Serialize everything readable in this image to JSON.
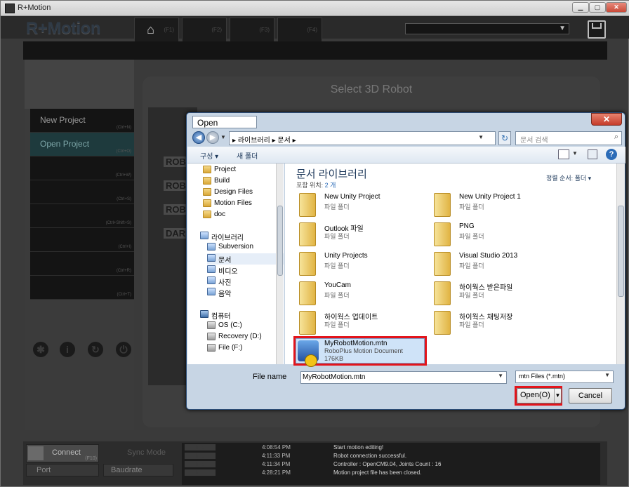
{
  "window": {
    "title": "R+Motion"
  },
  "header": {
    "logo": "R+Motion",
    "tabs": [
      {
        "label": "(F1)"
      },
      {
        "label": "(F2)"
      },
      {
        "label": "(F3)"
      },
      {
        "label": "(F4)"
      }
    ]
  },
  "main": {
    "select_title": "Select 3D Robot",
    "robots": [
      "ROB",
      "ROB",
      "ROB",
      "DAR"
    ]
  },
  "left_menu": {
    "items": [
      {
        "label": "New Project",
        "shortcut": "(Ctrl+N)"
      },
      {
        "label": "Open Project",
        "shortcut": "(Ctrl+O)"
      },
      {
        "label": "",
        "shortcut": "(Ctrl+W)"
      },
      {
        "label": "",
        "shortcut": "(Ctrl+S)"
      },
      {
        "label": "",
        "shortcut": "(Ctrl+Shift+S)"
      },
      {
        "label": "",
        "shortcut": "(Ctrl+I)"
      },
      {
        "label": "",
        "shortcut": "(Ctrl+R)"
      },
      {
        "label": "",
        "shortcut": "(Ctrl+T)"
      }
    ]
  },
  "status": {
    "connect": "Connect",
    "connect_shortcut": "(F10)",
    "sync_mode": "Sync Mode",
    "port": "Port",
    "baudrate": "Baudrate",
    "log": [
      {
        "level": "Info",
        "time": "4:08:54 PM",
        "msg": "Start motion editing!"
      },
      {
        "level": "Info",
        "time": "4:11:33 PM",
        "msg": "Robot connection successful."
      },
      {
        "level": "Info",
        "time": "4:11:34 PM",
        "msg": "Controller : OpenCM9.04, Joints Count : 16"
      },
      {
        "level": "Info",
        "time": "4:28:21 PM",
        "msg": "Motion project file has been closed."
      }
    ]
  },
  "dialog": {
    "title": "Open",
    "address": [
      "라이브러리",
      "문서"
    ],
    "search_placeholder": "문서 검색",
    "organize": "구성 ▾",
    "new_folder": "새 폴더",
    "nav": [
      {
        "label": "Project",
        "icon": "folder-icon"
      },
      {
        "label": "Build",
        "icon": "folder-icon"
      },
      {
        "label": "Design Files",
        "icon": "folder-icon"
      },
      {
        "label": "Motion Files",
        "icon": "folder-icon"
      },
      {
        "label": "doc",
        "icon": "folder-icon"
      },
      {
        "label": "라이브러리",
        "icon": "library-icon"
      },
      {
        "label": "Subversion",
        "icon": "library-icon"
      },
      {
        "label": "문서",
        "icon": "documents-icon"
      },
      {
        "label": "비디오",
        "icon": "video-icon"
      },
      {
        "label": "사진",
        "icon": "pictures-icon"
      },
      {
        "label": "음악",
        "icon": "music-icon"
      },
      {
        "label": "컴퓨터",
        "icon": "computer-icon"
      },
      {
        "label": "OS (C:)",
        "icon": "drive-icon"
      },
      {
        "label": "Recovery (D:)",
        "icon": "drive-icon"
      },
      {
        "label": "File (F:)",
        "icon": "drive-icon"
      }
    ],
    "library_title": "문서 라이브러리",
    "library_sub": "포함 위치:",
    "library_count": "2 개",
    "sort_label": "정렬 순서:  폴더 ▾",
    "files": [
      {
        "name": "New Unity Project",
        "type": "파일 폴더"
      },
      {
        "name": "New Unity Project 1",
        "type": "파일 폴더"
      },
      {
        "name": "Outlook 파일",
        "type": "파일 폴더"
      },
      {
        "name": "PNG",
        "type": "파일 폴더"
      },
      {
        "name": "Unity Projects",
        "type": "파일 폴더"
      },
      {
        "name": "Visual Studio 2013",
        "type": "파일 폴더"
      },
      {
        "name": "YouCam",
        "type": "파일 폴더"
      },
      {
        "name": "하이웍스 받은파일",
        "type": "파일 폴더"
      },
      {
        "name": "하이웍스 업데이트",
        "type": "파일 폴더"
      },
      {
        "name": "하이웍스 채팅저장",
        "type": "파일 폴더"
      }
    ],
    "selected_file": {
      "name": "MyRobotMotion.mtn",
      "type": "RoboPlus Motion Document",
      "size": "176KB"
    },
    "file_name_label": "File name",
    "file_name_value": "MyRobotMotion.mtn",
    "file_type": "mtn Files (*.mtn)",
    "open_label": "Open(O)",
    "cancel_label": "Cancel",
    "highlight_color": "#e3141b"
  }
}
